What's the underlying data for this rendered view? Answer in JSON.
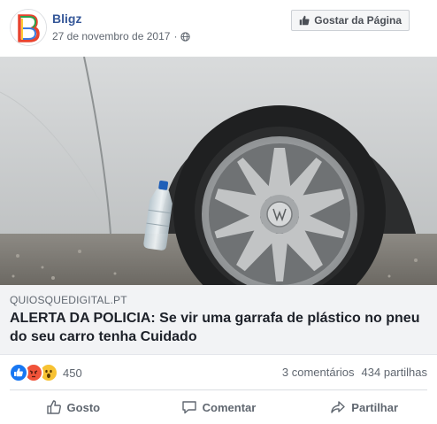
{
  "post": {
    "page_name": "Bligz",
    "date": "27 de novembro de 2017",
    "date_separator": "·",
    "privacy_icon": "globe-icon",
    "like_page_label": "Gostar da Página",
    "avatar_letter": "B"
  },
  "link": {
    "domain": "QUIOSQUEDIGITAL.PT",
    "headline": "ALERTA DA POLICIA: Se vir uma garrafa de plástico no pneu do seu carro tenha Cuidado"
  },
  "stats": {
    "reaction_icons": [
      "like-reaction-icon",
      "angry-reaction-icon",
      "wow-reaction-icon"
    ],
    "reaction_count": "450",
    "comments": "3 comentários",
    "shares": "434 partilhas"
  },
  "actions": {
    "like": "Gosto",
    "comment": "Comentar",
    "share": "Partilhar"
  },
  "colors": {
    "link_blue": "#365899",
    "fb_blue": "#1877f2",
    "angry": "#f0533a",
    "wow": "#f7c233"
  }
}
